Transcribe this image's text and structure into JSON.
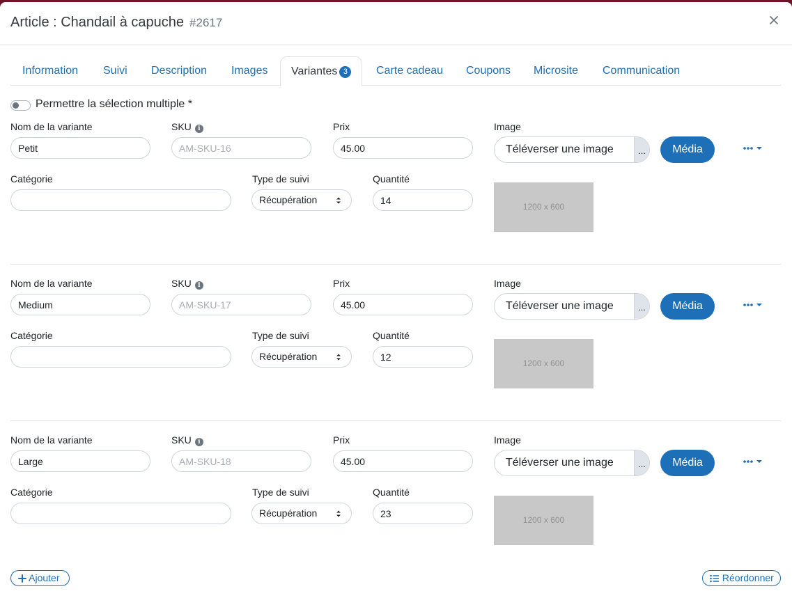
{
  "header": {
    "title": "Article : Chandail à capuche",
    "number": "#2617"
  },
  "tabs": [
    {
      "label": "Information"
    },
    {
      "label": "Suivi"
    },
    {
      "label": "Description"
    },
    {
      "label": "Images"
    },
    {
      "label": "Variantes",
      "badge": "3",
      "active": true
    },
    {
      "label": "Carte cadeau"
    },
    {
      "label": "Coupons"
    },
    {
      "label": "Microsite"
    },
    {
      "label": "Communication"
    }
  ],
  "multi_select": {
    "label": "Permettre la sélection multiple *",
    "enabled": false
  },
  "labels": {
    "name": "Nom de la variante",
    "sku": "SKU",
    "price": "Prix",
    "image": "Image",
    "category": "Catégorie",
    "tracking": "Type de suivi",
    "quantity": "Quantité",
    "upload": "Téléverser une image",
    "upload_browse": "...",
    "media": "Média",
    "more": "•••",
    "thumb": "1200 x 600"
  },
  "variants": [
    {
      "name": "Petit",
      "sku_placeholder": "AM-SKU-16",
      "price": "45.00",
      "category": "",
      "tracking": "Récupération",
      "quantity": "14"
    },
    {
      "name": "Medium",
      "sku_placeholder": "AM-SKU-17",
      "price": "45.00",
      "category": "",
      "tracking": "Récupération",
      "quantity": "12"
    },
    {
      "name": "Large",
      "sku_placeholder": "AM-SKU-18",
      "price": "45.00",
      "category": "",
      "tracking": "Récupération",
      "quantity": "23"
    }
  ],
  "footer": {
    "add_label": "Ajouter",
    "reorder_label": "Réordonner"
  },
  "colors": {
    "accent": "#1d70b7",
    "backdrop": "#7a1c2e",
    "border": "#ced4da"
  }
}
